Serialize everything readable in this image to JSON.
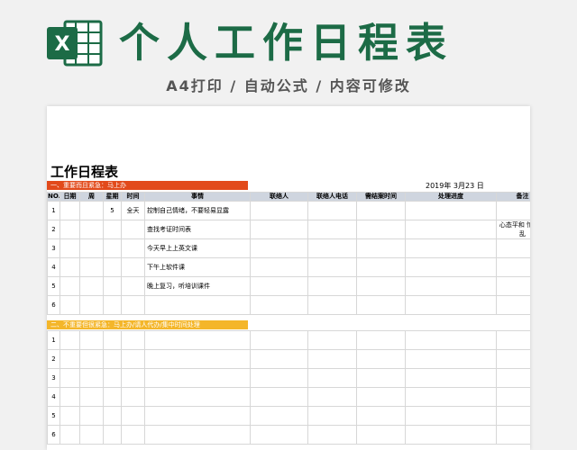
{
  "header": {
    "title": "个人工作日程表",
    "subtitle": "A4打印 / 自动公式 / 内容可修改",
    "logo_letter": "X"
  },
  "sheet": {
    "title": "工作日程表",
    "date": "2019年  3月23  日",
    "section1_label": "一、重要而且紧急：马上办",
    "section2_label": "二、不重要但很紧急：马上办/请人代办/集中时间处理",
    "columns": [
      "NO.",
      "日期",
      "周",
      "星期",
      "时间",
      "事情",
      "联络人",
      "联络人电话",
      "需结案时间",
      "处理进度",
      "备注"
    ],
    "section1_rows": [
      {
        "no": "1",
        "weekday": "5",
        "time": "全天",
        "task": "控制自己情绪，不要轻易显露",
        "note": ""
      },
      {
        "no": "2",
        "weekday": "",
        "time": "",
        "task": "查找考证时间表",
        "note": "心态平和 忙而不乱"
      },
      {
        "no": "3",
        "weekday": "",
        "time": "",
        "task": "今天早上上英文课",
        "note": ""
      },
      {
        "no": "4",
        "weekday": "",
        "time": "",
        "task": "下午上软件课",
        "note": ""
      },
      {
        "no": "5",
        "weekday": "",
        "time": "",
        "task": "晚上复习，听培训课件",
        "note": ""
      },
      {
        "no": "6",
        "weekday": "",
        "time": "",
        "task": "",
        "note": ""
      }
    ],
    "section2_rows": [
      {
        "no": "1"
      },
      {
        "no": "2"
      },
      {
        "no": "3"
      },
      {
        "no": "4"
      },
      {
        "no": "5"
      },
      {
        "no": "6"
      }
    ]
  },
  "colors": {
    "brand_green": "#1c6b46",
    "section1_bar": "#e24a1b",
    "section2_bar": "#f4b62a",
    "header_row": "#cfd5df"
  }
}
